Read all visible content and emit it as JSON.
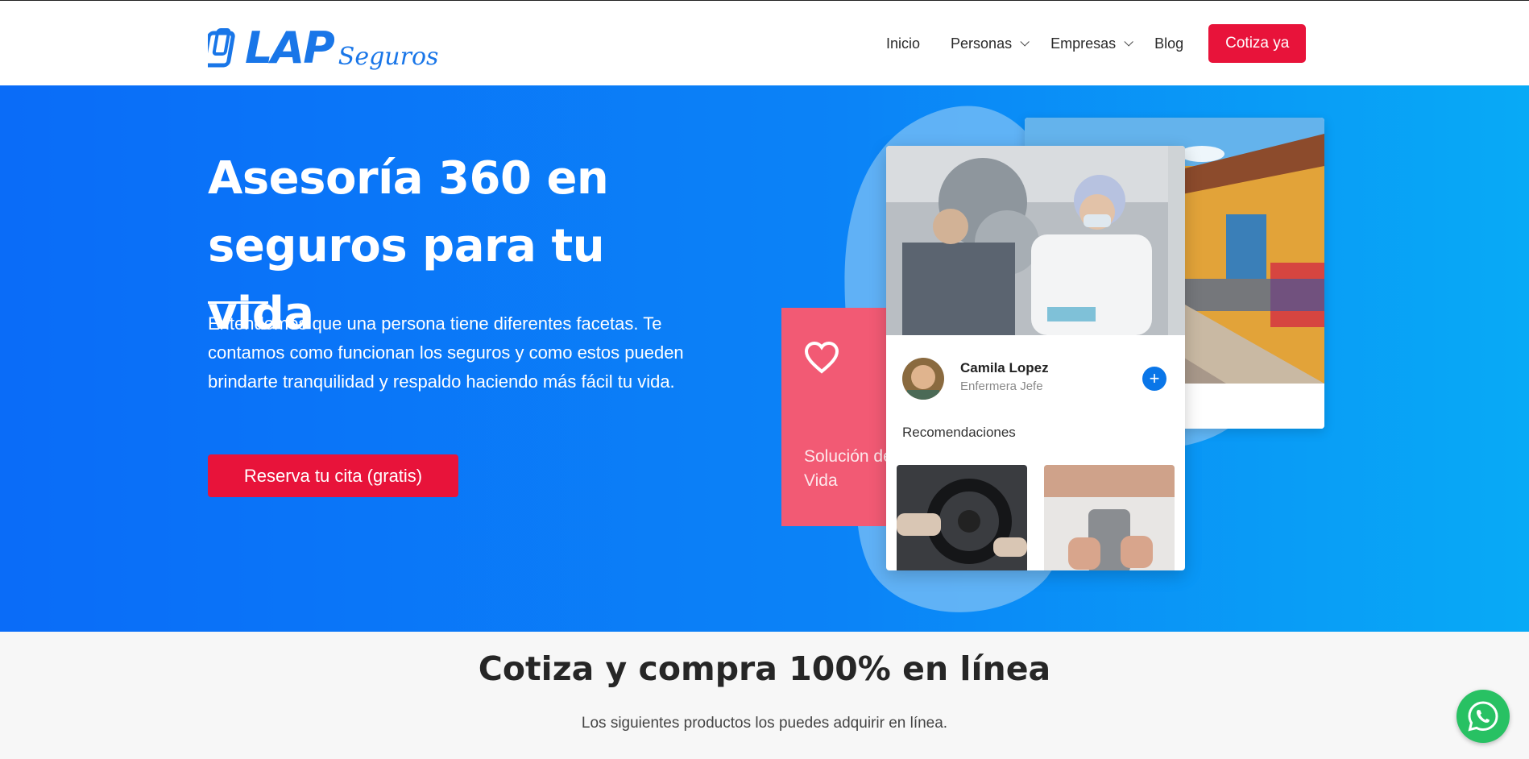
{
  "header": {
    "logo_main": "LAP",
    "logo_sub": "Seguros",
    "nav": [
      {
        "label": "Inicio"
      },
      {
        "label": "Personas"
      },
      {
        "label": "Empresas"
      },
      {
        "label": "Blog"
      }
    ],
    "cta": "Cotiza ya"
  },
  "hero": {
    "title": "Asesoría 360 en seguros para tu vida",
    "description": "Entendemos que una persona tiene diferentes facetas. Te contamos como funcionan los seguros y como estos pueden brindarte tranquilidad y respaldo haciendo más fácil tu vida.",
    "button": "Reserva tu cita (gratis)",
    "red_card_label": "Solución de\nVida",
    "profile": {
      "name": "Camila Lopez",
      "role": "Enfermera Jefe"
    },
    "recommendations_label": "Recomendaciones"
  },
  "section2": {
    "title": "Cotiza y compra 100% en línea",
    "subtitle": "Los siguientes productos los puedes adquirir en línea."
  },
  "colors": {
    "brand_blue": "#1976e8",
    "cta_red": "#e8133a",
    "card_pink": "#f25a74",
    "whatsapp_green": "#28c163"
  }
}
